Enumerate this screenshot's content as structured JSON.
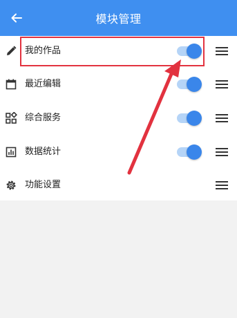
{
  "header": {
    "title": "模块管理",
    "back_icon": "arrow-left-icon"
  },
  "modules": [
    {
      "label": "我的作品",
      "icon": "pencil-icon",
      "enabled": true
    },
    {
      "label": "最近编辑",
      "icon": "calendar-icon",
      "enabled": true
    },
    {
      "label": "综合服务",
      "icon": "grid-apps-icon",
      "enabled": true
    },
    {
      "label": "数据统计",
      "icon": "bar-chart-icon",
      "enabled": true
    },
    {
      "label": "功能设置",
      "icon": "gear-icon",
      "enabled": null
    }
  ],
  "colors": {
    "header": "#3f8ff0",
    "toggle_on": "#3a86ea",
    "annotation": "#e2323f"
  }
}
